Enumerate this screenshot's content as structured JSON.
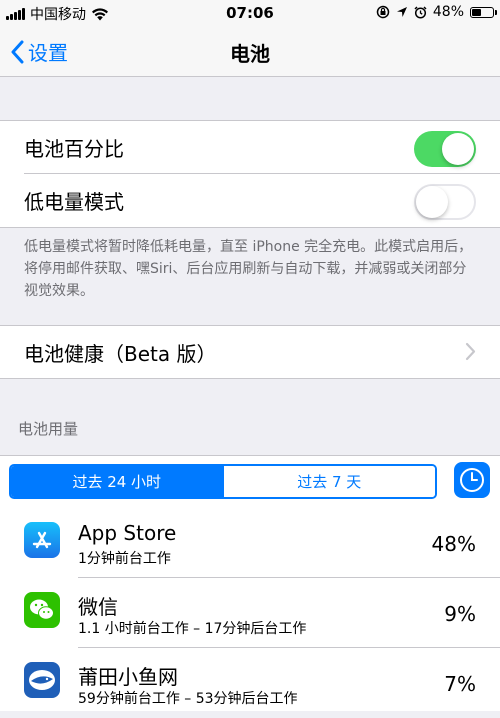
{
  "status_bar": {
    "carrier": "中国移动",
    "time": "07:06",
    "battery": "48%",
    "battery_level": 0.48,
    "icons": [
      "signal-icon",
      "wifi-icon",
      "orientation-lock-icon",
      "location-icon",
      "alarm-icon",
      "battery-icon"
    ]
  },
  "nav": {
    "back_label": "设置",
    "title": "电池"
  },
  "settings": {
    "battery_percentage_label": "电池百分比",
    "battery_percentage_on": true,
    "low_power_label": "低电量模式",
    "low_power_on": false,
    "low_power_note": "低电量模式将暂时降低耗电量，直至 iPhone 完全充电。此模式启用后，将停用邮件获取、嘿Siri、后台应用刷新与自动下载，并减弱或关闭部分视觉效果。",
    "battery_health_label": "电池健康（Beta 版）"
  },
  "usage": {
    "section_header": "电池用量",
    "tabs": [
      "过去 24 小时",
      "过去 7 天"
    ],
    "active_tab": 0,
    "apps": [
      {
        "name": "App Store",
        "detail": "1分钟前台工作",
        "percent": "48%",
        "icon": "app-store-icon",
        "color": "#1a8cf0"
      },
      {
        "name": "微信",
        "detail": "1.1 小时前台工作 – 17分钟后台工作",
        "percent": "9%",
        "icon": "wechat-icon",
        "color": "#2dc100"
      },
      {
        "name": "莆田小鱼网",
        "detail": "59分钟前台工作 – 53分钟后台工作",
        "percent": "7%",
        "icon": "putian-xiaoyu-icon",
        "color": "#1f5fb8"
      }
    ]
  },
  "colors": {
    "accent": "#007aff",
    "toggle_on": "#4cd964",
    "background": "#efeff4"
  }
}
